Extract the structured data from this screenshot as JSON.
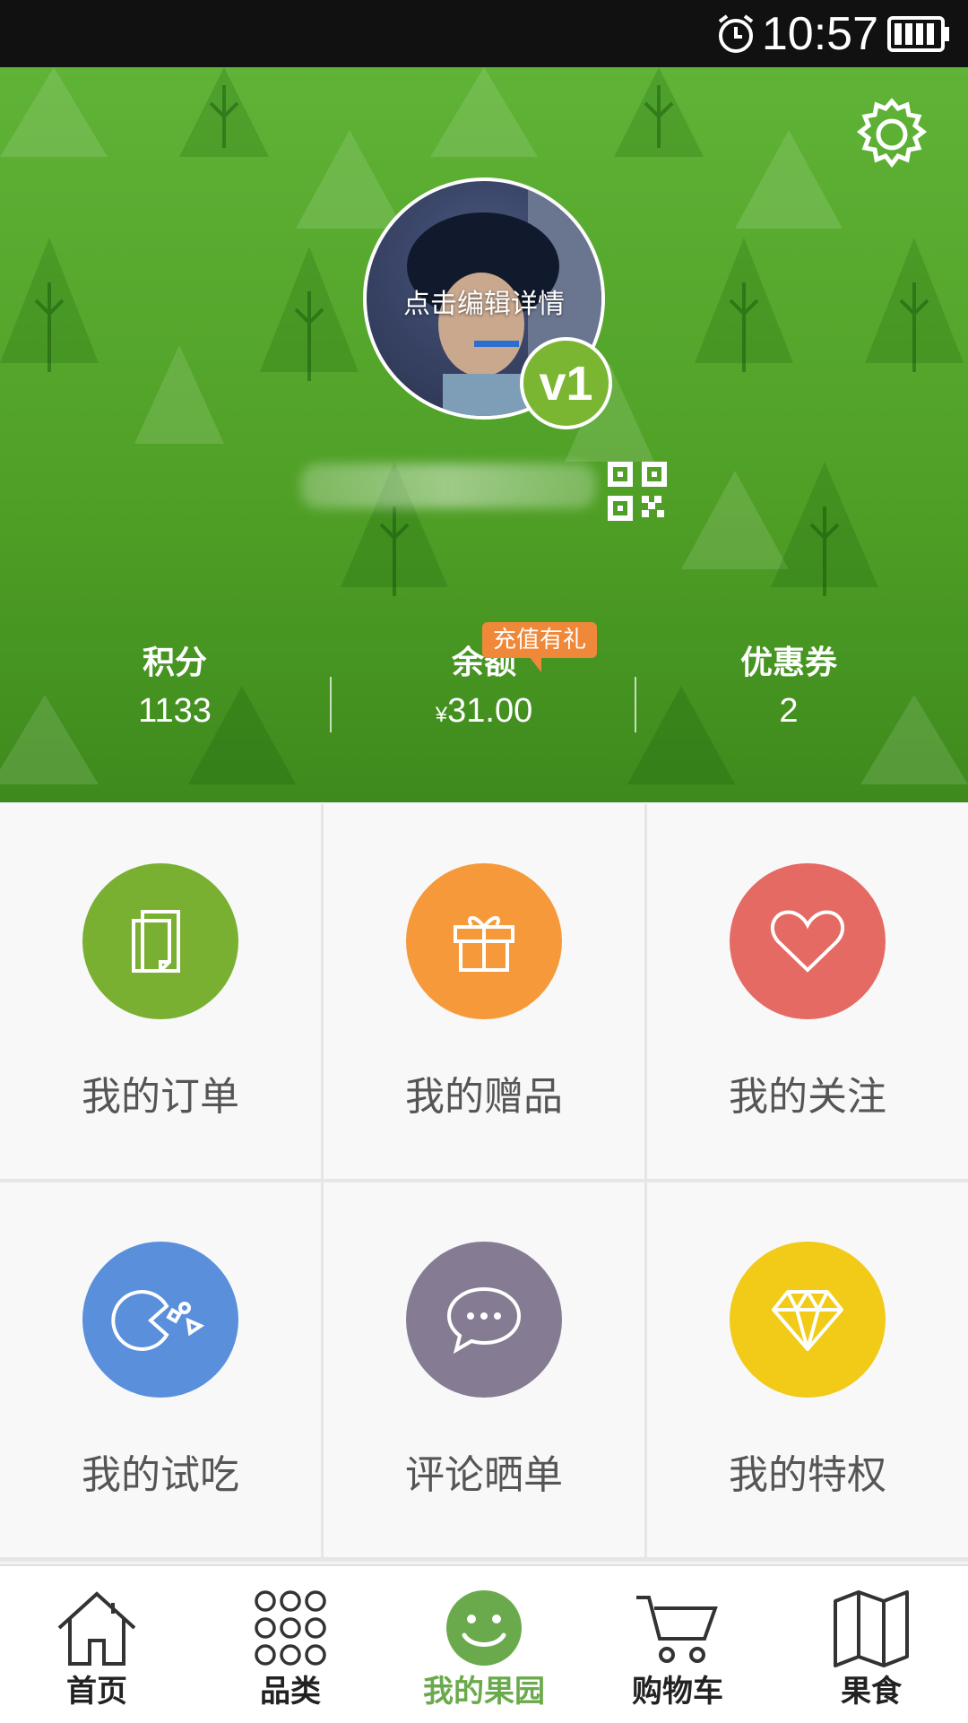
{
  "status_bar": {
    "time": "10:57"
  },
  "profile": {
    "avatar_hint": "点击编辑详情",
    "level": "v1"
  },
  "stats": {
    "points": {
      "label": "积分",
      "value": "1133"
    },
    "balance": {
      "label": "余额",
      "currency": "¥",
      "value": "31.00",
      "promo": "充值有礼"
    },
    "coupons": {
      "label": "优惠券",
      "value": "2"
    }
  },
  "grid": [
    {
      "label": "我的订单",
      "color": "#7ab032",
      "icon": "documents-icon"
    },
    {
      "label": "我的赠品",
      "color": "#f6993a",
      "icon": "gift-icon"
    },
    {
      "label": "我的关注",
      "color": "#e46a63",
      "icon": "heart-icon"
    },
    {
      "label": "我的试吃",
      "color": "#5a8fdc",
      "icon": "tasting-icon"
    },
    {
      "label": "评论晒单",
      "color": "#857c93",
      "icon": "chat-bubble-icon"
    },
    {
      "label": "我的特权",
      "color": "#f1cb17",
      "icon": "diamond-icon"
    }
  ],
  "nav": [
    {
      "label": "首页",
      "icon": "home-icon"
    },
    {
      "label": "品类",
      "icon": "grid-dots-icon"
    },
    {
      "label": "我的果园",
      "icon": "smiley-icon",
      "active": true
    },
    {
      "label": "购物车",
      "icon": "cart-icon"
    },
    {
      "label": "果食",
      "icon": "map-icon"
    }
  ]
}
